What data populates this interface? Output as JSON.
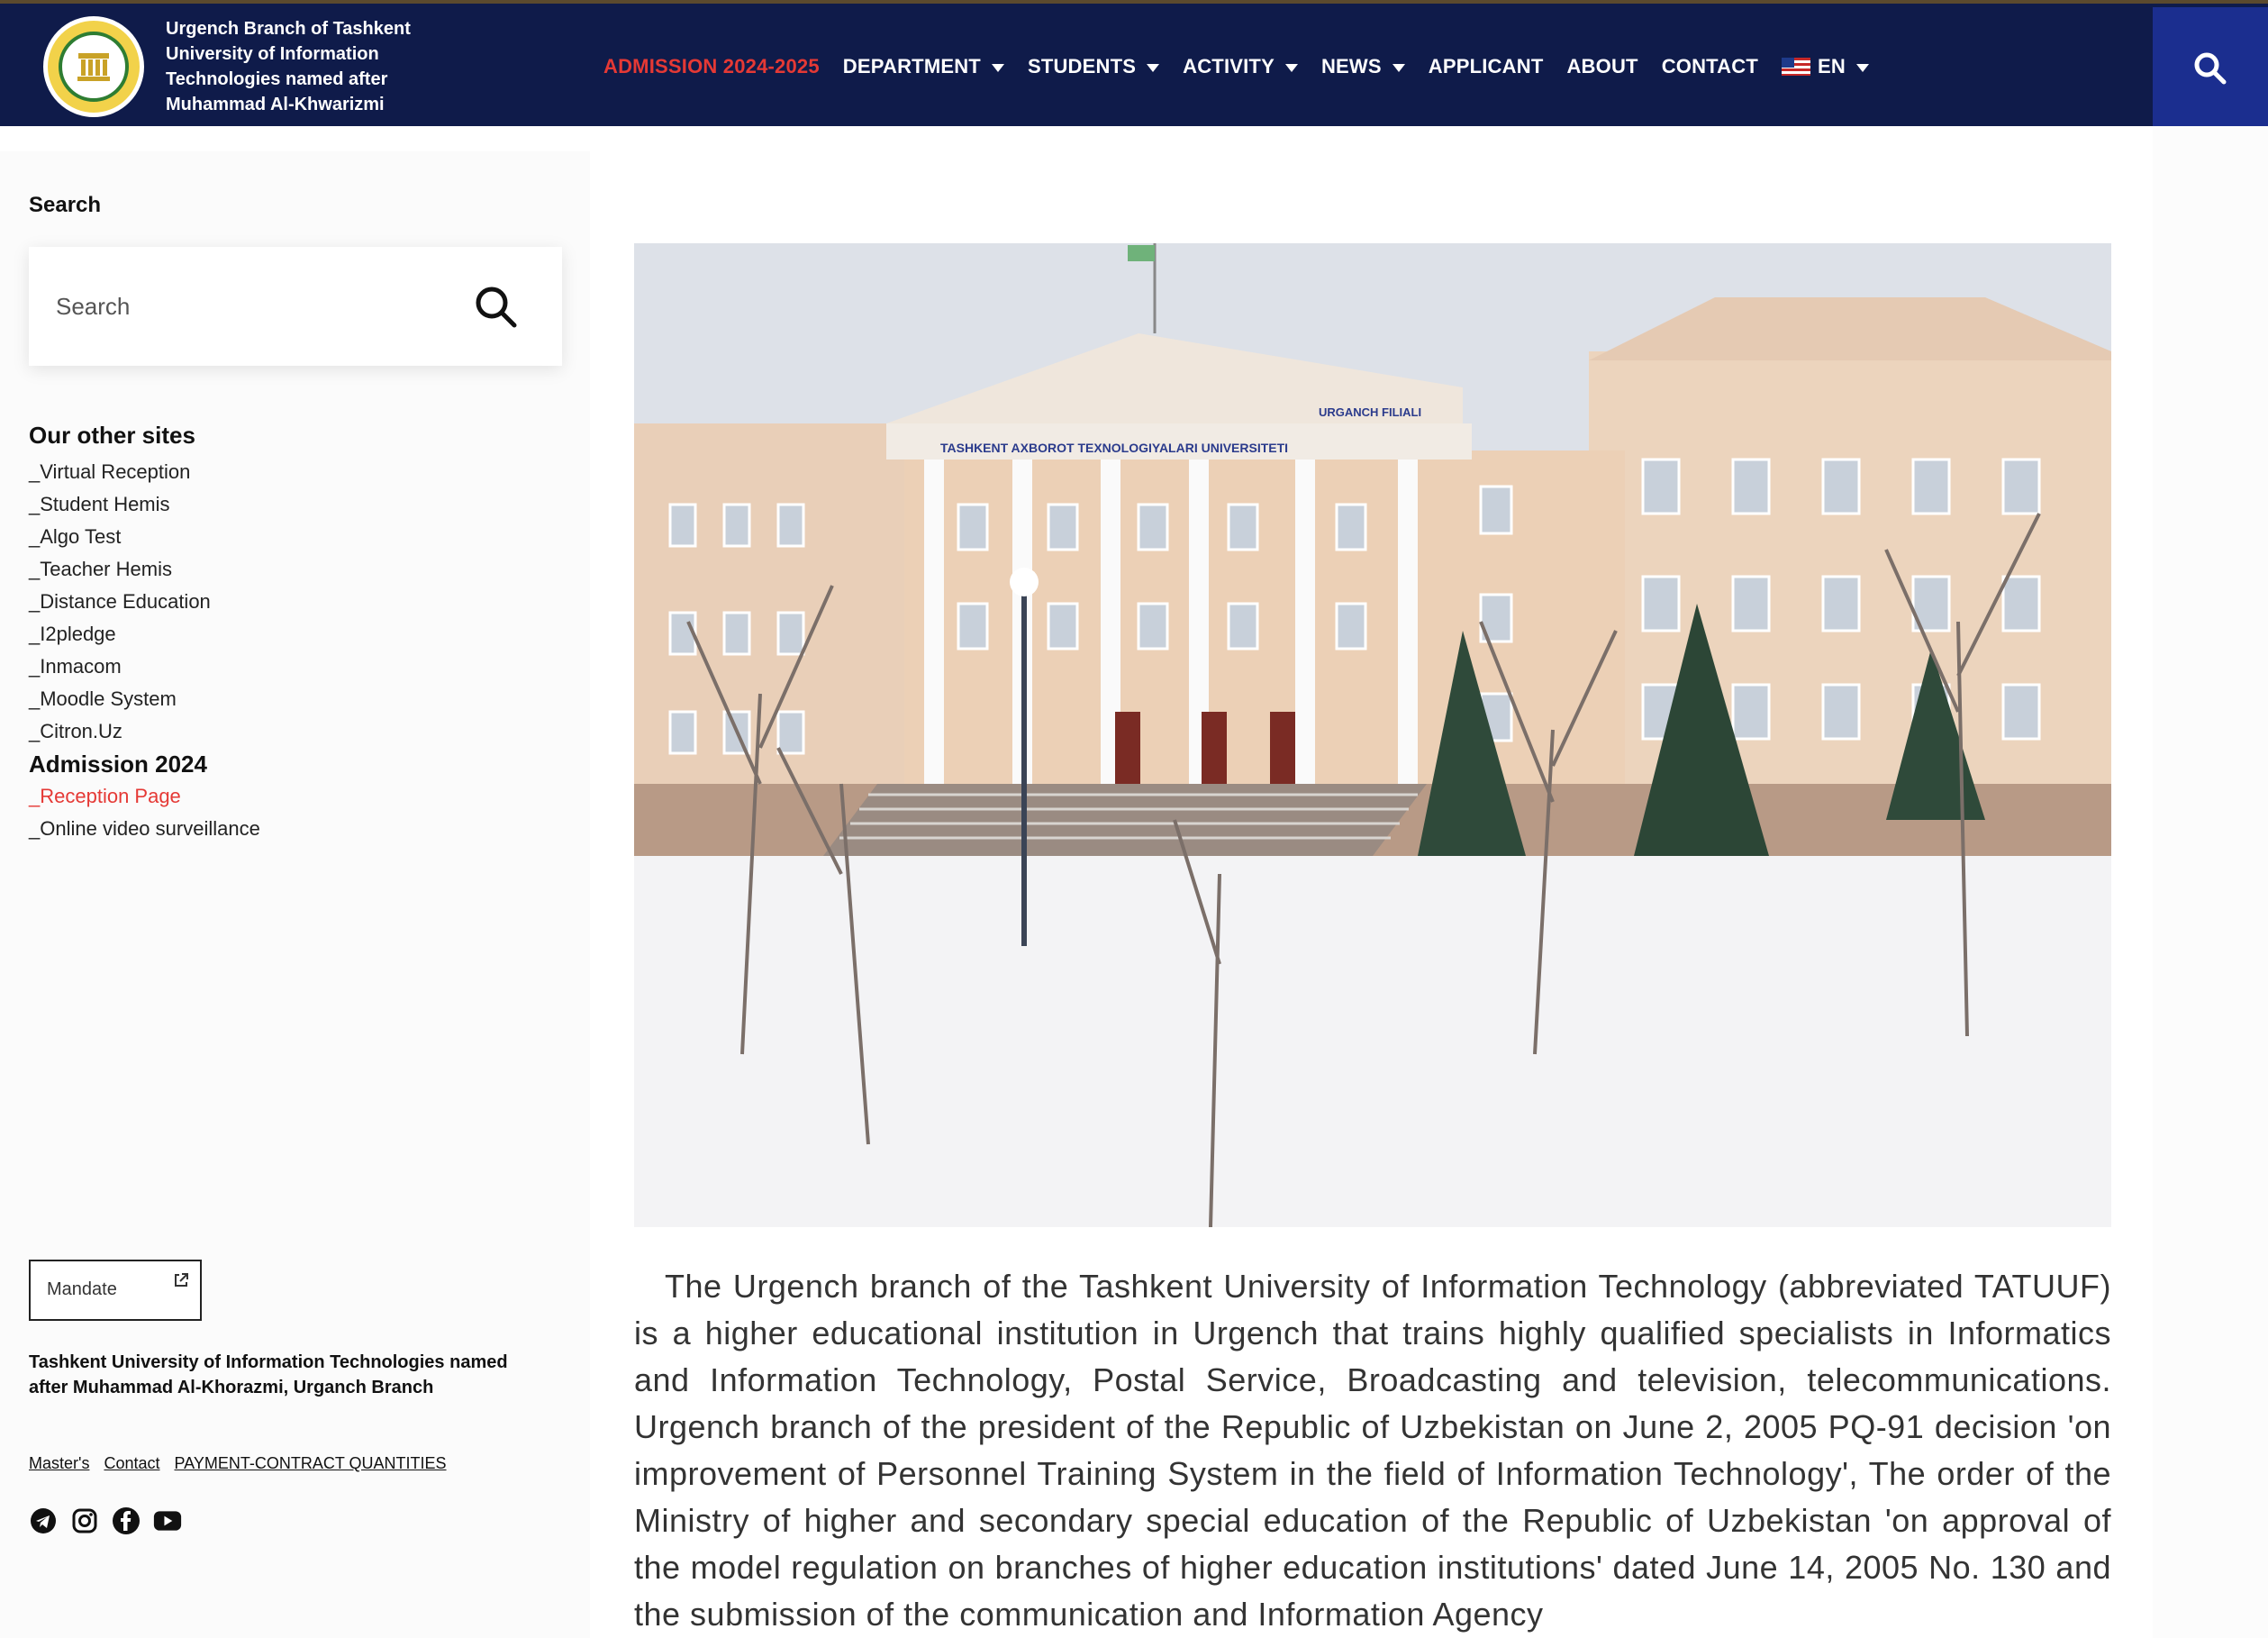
{
  "brand": {
    "line1": "Urgench Branch of Tashkent",
    "line2": "University of Information",
    "line3": "Technologies named after",
    "line4": "Muhammad Al-Khwarizmi"
  },
  "nav": {
    "items": [
      {
        "label": "ADMISSION 2024-2025",
        "active": true,
        "dropdown": false
      },
      {
        "label": "DEPARTMENT",
        "dropdown": true
      },
      {
        "label": "STUDENTS",
        "dropdown": true
      },
      {
        "label": "ACTIVITY",
        "dropdown": true
      },
      {
        "label": "NEWS",
        "dropdown": true
      },
      {
        "label": "APPLICANT",
        "dropdown": false
      },
      {
        "label": "ABOUT",
        "dropdown": false
      },
      {
        "label": "CONTACT",
        "dropdown": false
      }
    ],
    "language": "EN"
  },
  "sidebar": {
    "search_title": "Search",
    "search_placeholder": "Search",
    "sites_title": "Our other sites",
    "sites": [
      "_Virtual Reception",
      "_Student Hemis",
      "_Algo Test",
      "_Teacher Hemis",
      "_Distance Education",
      "_I2pledge",
      "_Inmacom",
      "_Moodle System",
      "_Citron.Uz"
    ],
    "admission_title": "Admission 2024",
    "admission_links": [
      "_Reception Page",
      "_Online video surveillance"
    ],
    "mandate_label": "Mandate",
    "footer_org": "Tashkent University of Information Technologies named after Muhammad Al-Khorazmi, Urganch Branch",
    "footer_links": [
      "Master's",
      "Contact",
      "PAYMENT-CONTRACT QUANTITIES"
    ]
  },
  "main": {
    "building_sign_left": "TASHKENT AXBOROT TEXNOLOGIYALARI UNIVERSITETI",
    "building_sign_right": "URGANCH FILIALI",
    "paragraph": "The Urgench branch of the Tashkent University of Information Technology (abbreviated TATUUF) is a higher educational institution in Urgench that trains highly qualified specialists in Informatics and Information Technology, Postal Service, Broadcasting and television, telecommunications. Urgench branch of the president of the Republic of Uzbekistan on June 2, 2005 PQ-91 decision 'on improvement of Personnel Training System in the field of Information Technology', The order of the Ministry of higher and secondary special education of the Republic of Uzbekistan 'on approval of the model regulation on branches of higher education institutions' dated June 14, 2005 No. 130 and the submission of the communication and Information Agency"
  },
  "colors": {
    "navbar": "#0f1b4a",
    "search_button": "#1b2e8f",
    "accent_red": "#e53935"
  }
}
